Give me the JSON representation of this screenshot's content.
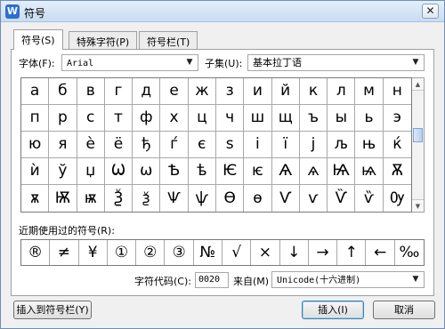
{
  "window": {
    "title": "符号",
    "app_icon": "W"
  },
  "tabs": [
    {
      "label": "符号(S)"
    },
    {
      "label": "特殊字符(P)"
    },
    {
      "label": "符号栏(T)"
    }
  ],
  "font": {
    "label": "字体(F):",
    "value": "Arial"
  },
  "subset": {
    "label": "子集(U):",
    "value": "基本拉丁语"
  },
  "symbols": [
    "а",
    "б",
    "в",
    "г",
    "д",
    "е",
    "ж",
    "з",
    "и",
    "й",
    "к",
    "л",
    "м",
    "н",
    "п",
    "р",
    "с",
    "т",
    "ф",
    "х",
    "ц",
    "ч",
    "ш",
    "щ",
    "ъ",
    "ы",
    "ь",
    "э",
    "ю",
    "я",
    "è",
    "ë",
    "ђ",
    "ѓ",
    "є",
    "ѕ",
    "і",
    "ї",
    "ј",
    "љ",
    "њ",
    "ќ",
    "ѝ",
    "ў",
    "џ",
    "Ѡ",
    "ѡ",
    "Ѣ",
    "ѣ",
    "Ѥ",
    "ѥ",
    "Ѧ",
    "ѧ",
    "Ѩ",
    "ѩ",
    "Ѫ",
    "ѫ",
    "Ѭ",
    "ѭ",
    "Ѯ",
    "ѯ",
    "Ѱ",
    "ѱ",
    "Ѳ",
    "ѳ",
    "Ѵ",
    "ѵ",
    "Ѷ",
    "ѷ",
    "Ѹ"
  ],
  "recent": {
    "label": "近期使用过的符号(R):",
    "symbols": [
      "®",
      "≠",
      "¥",
      "①",
      "②",
      "③",
      "№",
      "√",
      "×",
      "↓",
      "→",
      "↑",
      "←",
      "‰"
    ]
  },
  "char_code": {
    "label": "字符代码(C):",
    "value": "0020"
  },
  "from": {
    "label": "来自(M)",
    "value": "Unicode(十六进制)"
  },
  "buttons": {
    "insert_to_bar": "插入到符号栏(Y)",
    "insert": "插入(I)",
    "cancel": "取消"
  }
}
